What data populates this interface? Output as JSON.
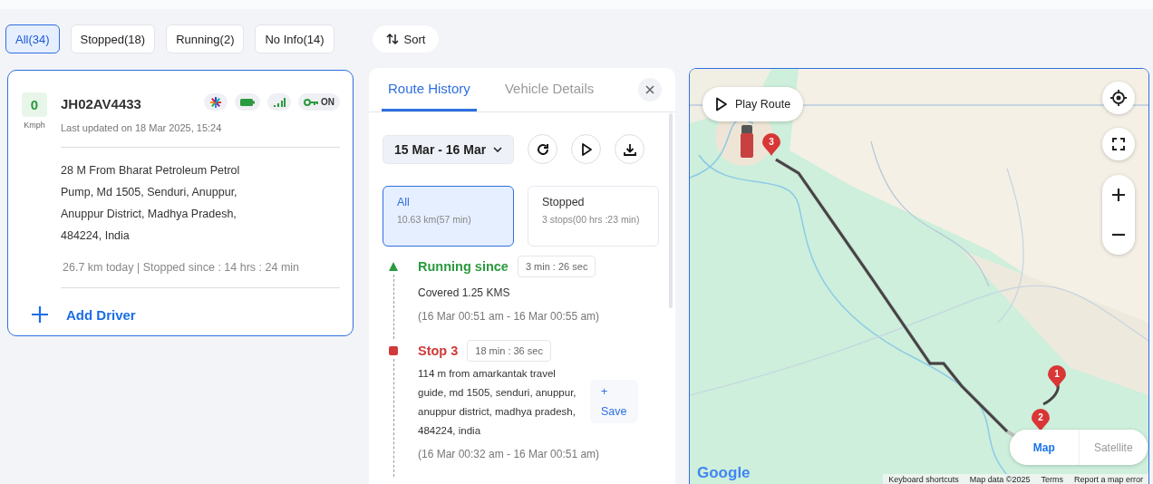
{
  "filters": [
    {
      "label": "All(34)",
      "selected": true
    },
    {
      "label": "Stopped(18)",
      "selected": false
    },
    {
      "label": "Running(2)",
      "selected": false
    },
    {
      "label": "No Info(14)",
      "selected": false
    }
  ],
  "sort_button": {
    "label": "Sort"
  },
  "vehicle": {
    "speed": "0",
    "speed_unit": "Kmph",
    "plate": "JH02AV4433",
    "ignition": "ON",
    "last_updated": "Last updated on 18 Mar 2025, 15:24",
    "address": "28 M From Bharat Petroleum Petrol Pump, Md 1505, Senduri, Anuppur, Anuppur District, Madhya Pradesh, 484224, India",
    "summary": "26.7 km today | Stopped since : 14 hrs : 24 min",
    "add_driver": "Add Driver"
  },
  "panel": {
    "tabs": [
      {
        "label": "Route History",
        "selected": true
      },
      {
        "label": "Vehicle Details",
        "selected": false
      }
    ],
    "date_range": "15 Mar - 16 Mar",
    "segments": [
      {
        "title": "All",
        "detail": "10.63 km(57 min)",
        "selected": true
      },
      {
        "title": "Stopped",
        "detail": "3 stops(00 hrs :23 min)",
        "selected": false
      }
    ],
    "timeline": [
      {
        "kind": "running",
        "title": "Running since",
        "duration": "3 min : 26 sec",
        "text": "Covered 1.25 KMS",
        "time": "(16 Mar 00:51 am - 16 Mar 00:55 am)"
      },
      {
        "kind": "stop",
        "title": "Stop 3",
        "duration": "18 min : 36 sec",
        "text": "114 m from amarkantak travel guide, md 1505, senduri, anuppur, anuppur district, madhya pradesh, 484224, india",
        "save_icon": "+",
        "save": "Save",
        "time": "(16 Mar 00:32 am - 16 Mar 00:51 am)"
      }
    ]
  },
  "map": {
    "play_route": "Play Route",
    "markers": [
      {
        "label": "3"
      },
      {
        "label": "1"
      },
      {
        "label": "2"
      }
    ],
    "map_types": [
      {
        "label": "Map",
        "selected": true
      },
      {
        "label": "Satellite",
        "selected": false
      }
    ],
    "logo": "Google",
    "attribution": [
      "Keyboard shortcuts",
      "Map data ©2025",
      "Terms",
      "Report a map error"
    ]
  }
}
